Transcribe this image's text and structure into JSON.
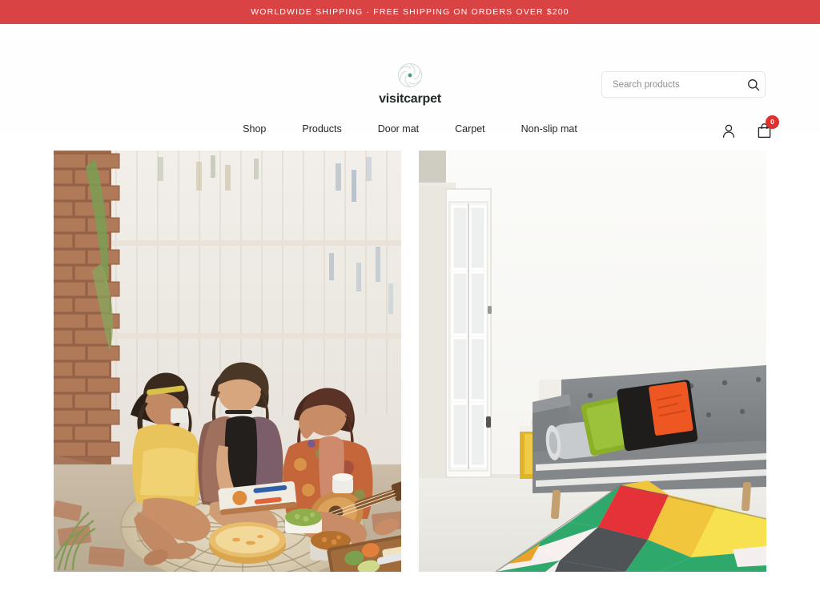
{
  "announcement": {
    "text": "WORLDWIDE SHIPPING · FREE SHIPPING ON ORDERS OVER $200",
    "background_color": "#d94343",
    "text_color": "#ffffff"
  },
  "brand": {
    "name": "visitcarpet",
    "logo_icon": "aperture-pinwheel-icon",
    "logo_center_color": "#3f9e6f",
    "logo_blade_color": "#d6dedb"
  },
  "search": {
    "placeholder": "Search products",
    "value": "",
    "icon": "search-icon"
  },
  "nav": {
    "items": [
      {
        "label": "Shop"
      },
      {
        "label": "Products"
      },
      {
        "label": "Door mat"
      },
      {
        "label": "Carpet"
      },
      {
        "label": "Non-slip mat"
      }
    ]
  },
  "utilities": {
    "account": {
      "icon": "user-account-icon",
      "label": "Account"
    },
    "cart": {
      "icon": "shopping-bag-icon",
      "label": "Cart",
      "count": "0",
      "badge_color": "#e03131"
    }
  },
  "hero": {
    "tiles": [
      {
        "name": "outdoor-picnic-rug-banner",
        "alt": "Three women sitting outdoors on a round woven jute rug with bowls of food in front of a white picket fence and brick wall"
      },
      {
        "name": "living-room-geometric-rug-banner",
        "alt": "Bright white living room with grey tufted sofa, colourful cushions and a geometric multicolour rug"
      }
    ]
  },
  "theme": {
    "page_background": "#ffffff",
    "header_background": "#fdfefd",
    "text_primary": "#1f2426",
    "text_muted": "#8e8e8e",
    "border": "#e6e6e6"
  }
}
